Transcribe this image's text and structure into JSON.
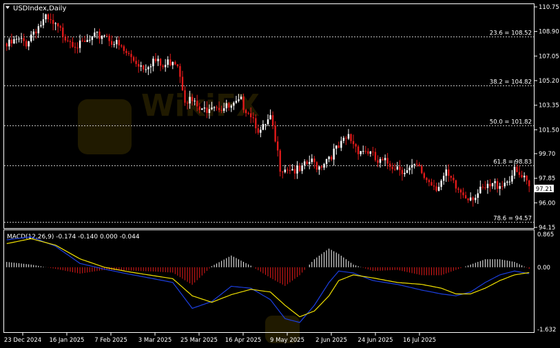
{
  "window": {
    "title": "USDIndex,Daily",
    "current_price": "97.21"
  },
  "macd": {
    "label": "MACD(12,26,9) -0.174 -0.140 0.000 -0.044"
  },
  "watermark": {
    "text": "WikiFX"
  },
  "price_axis": [
    "110.75",
    "108.90",
    "107.05",
    "105.20",
    "103.35",
    "101.50",
    "99.70",
    "97.85",
    "96.00",
    "94.15"
  ],
  "macd_axis": [
    "0.865",
    "0.00",
    "-1.632"
  ],
  "fibonacci": [
    {
      "label": "23.6 = 108.52",
      "price": 108.52
    },
    {
      "label": "38.2 = 104.82",
      "price": 104.82
    },
    {
      "label": "50.0 = 101.82",
      "price": 101.82
    },
    {
      "label": "61.8 = 98.83",
      "price": 98.83
    },
    {
      "label": "78.6 = 94.57",
      "price": 94.57
    }
  ],
  "date_axis": [
    "23 Dec 2024",
    "16 Jan 2025",
    "7 Feb 2025",
    "3 Mar 2025",
    "25 Mar 2025",
    "16 Apr 2025",
    "9 May 2025",
    "2 Jun 2025",
    "24 Jun 2025",
    "16 Jul 2025"
  ],
  "colors": {
    "up": "#ffffff",
    "down": "#e31a1a",
    "signal": "#f2e200",
    "macd_line": "#1c3fe0",
    "grid": "#ffffff",
    "axis": "#ffffff"
  },
  "chart_data": {
    "type": "candlestick",
    "price_range": [
      94.15,
      110.75
    ],
    "macd_range": [
      -1.632,
      0.865
    ],
    "close_anchors": [
      [
        0,
        108.0
      ],
      [
        4,
        108.4
      ],
      [
        8,
        108.3
      ],
      [
        11,
        109.2
      ],
      [
        16,
        110.0
      ],
      [
        20,
        109.4
      ],
      [
        25,
        108.7
      ],
      [
        30,
        108.0
      ],
      [
        35,
        108.5
      ],
      [
        40,
        109.0
      ],
      [
        44,
        108.3
      ],
      [
        48,
        107.6
      ],
      [
        52,
        107.0
      ],
      [
        56,
        106.5
      ],
      [
        60,
        107.0
      ],
      [
        64,
        106.4
      ],
      [
        68,
        107.1
      ],
      [
        70,
        106.8
      ],
      [
        73,
        104.2
      ],
      [
        76,
        103.8
      ],
      [
        80,
        103.0
      ],
      [
        84,
        103.8
      ],
      [
        88,
        103.4
      ],
      [
        92,
        103.3
      ],
      [
        96,
        103.8
      ],
      [
        100,
        103.0
      ],
      [
        104,
        101.5
      ],
      [
        108,
        102.5
      ],
      [
        112,
        99.0
      ],
      [
        116,
        98.9
      ],
      [
        120,
        98.5
      ],
      [
        124,
        99.3
      ],
      [
        128,
        99.0
      ],
      [
        132,
        99.8
      ],
      [
        136,
        100.3
      ],
      [
        140,
        101.2
      ],
      [
        144,
        100.3
      ],
      [
        148,
        100.1
      ],
      [
        152,
        99.2
      ],
      [
        156,
        99.2
      ],
      [
        160,
        99.0
      ],
      [
        164,
        98.6
      ],
      [
        168,
        98.9
      ],
      [
        172,
        98.0
      ],
      [
        176,
        97.5
      ],
      [
        180,
        98.3
      ],
      [
        184,
        97.3
      ],
      [
        188,
        96.8
      ],
      [
        192,
        96.8
      ],
      [
        196,
        97.2
      ],
      [
        200,
        97.6
      ],
      [
        204,
        97.8
      ],
      [
        208,
        98.5
      ],
      [
        212,
        97.9
      ],
      [
        214,
        97.21
      ]
    ],
    "macd_main_anchors": [
      [
        0,
        0.72
      ],
      [
        10,
        0.8
      ],
      [
        20,
        0.55
      ],
      [
        30,
        0.1
      ],
      [
        40,
        -0.05
      ],
      [
        50,
        -0.18
      ],
      [
        60,
        -0.3
      ],
      [
        68,
        -0.4
      ],
      [
        76,
        -1.08
      ],
      [
        84,
        -0.9
      ],
      [
        92,
        -0.5
      ],
      [
        100,
        -0.55
      ],
      [
        108,
        -0.85
      ],
      [
        114,
        -1.35
      ],
      [
        120,
        -1.45
      ],
      [
        126,
        -1.0
      ],
      [
        132,
        -0.4
      ],
      [
        136,
        -0.1
      ],
      [
        142,
        -0.15
      ],
      [
        150,
        -0.35
      ],
      [
        160,
        -0.45
      ],
      [
        170,
        -0.6
      ],
      [
        178,
        -0.7
      ],
      [
        184,
        -0.75
      ],
      [
        190,
        -0.65
      ],
      [
        196,
        -0.4
      ],
      [
        202,
        -0.2
      ],
      [
        208,
        -0.1
      ],
      [
        214,
        -0.17
      ]
    ],
    "macd_signal_anchors": [
      [
        0,
        0.62
      ],
      [
        10,
        0.75
      ],
      [
        20,
        0.58
      ],
      [
        30,
        0.22
      ],
      [
        40,
        0.0
      ],
      [
        50,
        -0.12
      ],
      [
        60,
        -0.22
      ],
      [
        68,
        -0.3
      ],
      [
        76,
        -0.75
      ],
      [
        84,
        -0.92
      ],
      [
        92,
        -0.72
      ],
      [
        100,
        -0.58
      ],
      [
        108,
        -0.65
      ],
      [
        114,
        -1.0
      ],
      [
        120,
        -1.3
      ],
      [
        126,
        -1.15
      ],
      [
        132,
        -0.75
      ],
      [
        136,
        -0.35
      ],
      [
        142,
        -0.2
      ],
      [
        150,
        -0.28
      ],
      [
        160,
        -0.4
      ],
      [
        170,
        -0.45
      ],
      [
        178,
        -0.55
      ],
      [
        184,
        -0.7
      ],
      [
        190,
        -0.7
      ],
      [
        196,
        -0.55
      ],
      [
        202,
        -0.35
      ],
      [
        208,
        -0.2
      ],
      [
        214,
        -0.14
      ]
    ]
  }
}
